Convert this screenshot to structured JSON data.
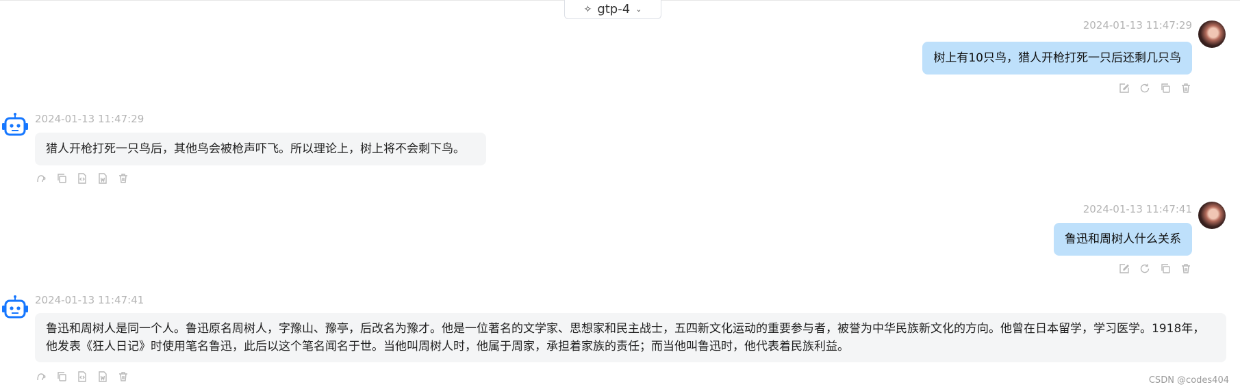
{
  "header": {
    "model": "gtp-4",
    "model_icon": "sparkle-icon",
    "dropdown_icon": "chevron-down-icon"
  },
  "messages": [
    {
      "role": "user",
      "timestamp": "2024-01-13 11:47:29",
      "text": "树上有10只鸟，猎人开枪打死一只后还剩几只鸟"
    },
    {
      "role": "assistant",
      "timestamp": "2024-01-13 11:47:29",
      "text": "猎人开枪打死一只鸟后，其他鸟会被枪声吓飞。所以理论上，树上将不会剩下鸟。"
    },
    {
      "role": "user",
      "timestamp": "2024-01-13 11:47:41",
      "text": "鲁迅和周树人什么关系"
    },
    {
      "role": "assistant",
      "timestamp": "2024-01-13 11:47:41",
      "text": "鲁迅和周树人是同一个人。鲁迅原名周树人，字豫山、豫亭，后改名为豫才。他是一位著名的文学家、思想家和民主战士，五四新文化运动的重要参与者，被誉为中华民族新文化的方向。他曾在日本留学，学习医学。1918年，他发表《狂人日记》时使用笔名鲁迅，此后以这个笔名闻名于世。当他叫周树人时，他属于周家，承担着家族的责任；而当他叫鲁迅时，他代表着民族利益。"
    }
  ],
  "user_actions": [
    "edit-icon",
    "regenerate-icon",
    "copy-icon",
    "delete-icon"
  ],
  "assistant_actions": [
    "speak-icon",
    "copy-icon",
    "code-icon",
    "word-export-icon",
    "delete-icon"
  ],
  "watermark": "CSDN @codes404"
}
